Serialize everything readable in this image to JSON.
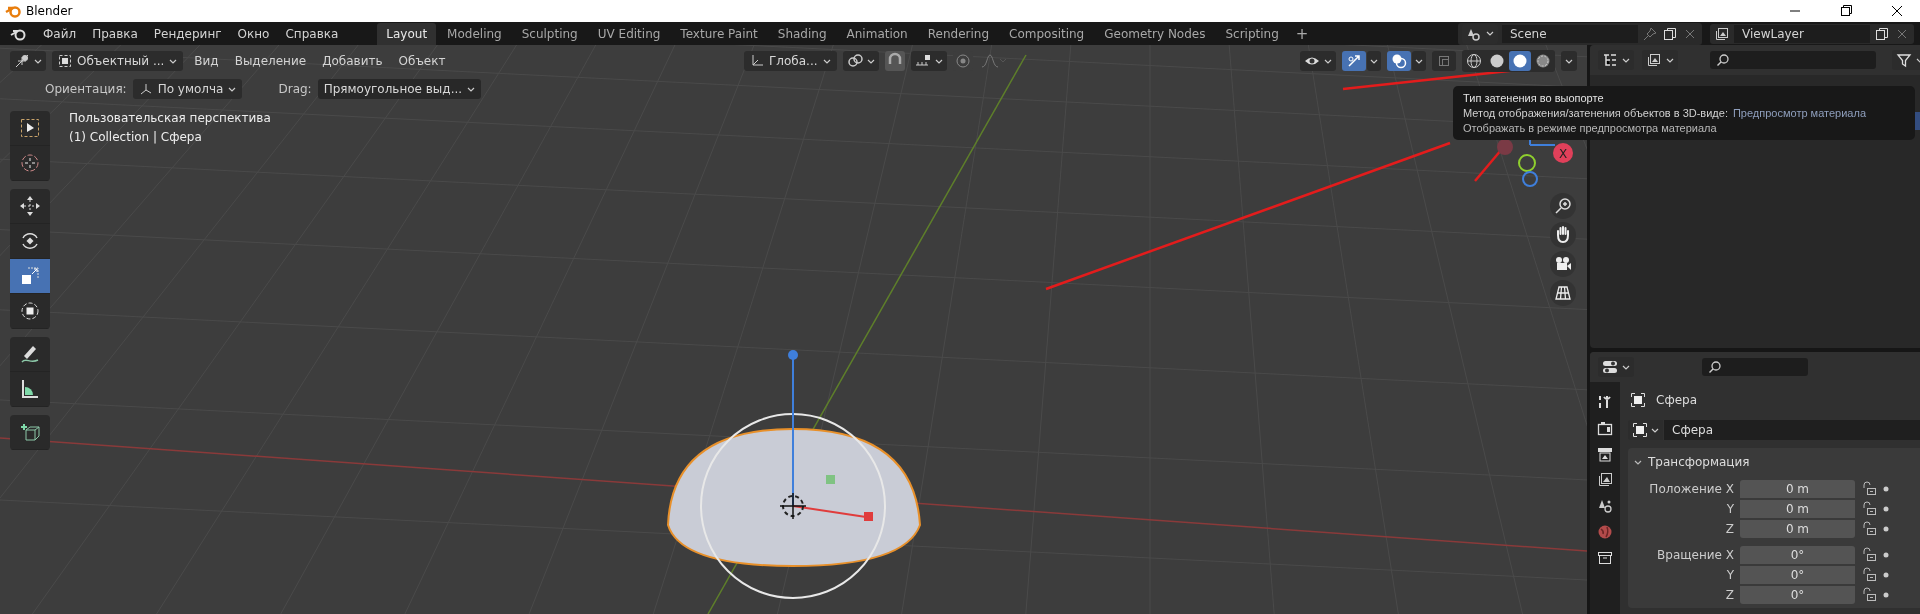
{
  "window": {
    "title": "Blender"
  },
  "menu": [
    "Файл",
    "Правка",
    "Рендеринг",
    "Окно",
    "Справка"
  ],
  "workspaces": [
    {
      "label": "Layout",
      "selected": true
    },
    {
      "label": "Modeling",
      "selected": false
    },
    {
      "label": "Sculpting",
      "selected": false
    },
    {
      "label": "UV Editing",
      "selected": false
    },
    {
      "label": "Texture Paint",
      "selected": false
    },
    {
      "label": "Shading",
      "selected": false
    },
    {
      "label": "Animation",
      "selected": false
    },
    {
      "label": "Rendering",
      "selected": false
    },
    {
      "label": "Compositing",
      "selected": false
    },
    {
      "label": "Geometry Nodes",
      "selected": false
    },
    {
      "label": "Scripting",
      "selected": false
    }
  ],
  "add_workspace": "+",
  "scene": {
    "name": "Scene"
  },
  "view_layer": {
    "name": "ViewLayer"
  },
  "viewport": {
    "mode": "Объектный ...",
    "menus": [
      "Вид",
      "Выделение",
      "Добавить",
      "Объект"
    ],
    "orientation": "Глоба...",
    "toggles": [
      {
        "kind": "gizmos",
        "on": true
      },
      {
        "kind": "overlays",
        "on": true
      },
      {
        "kind": "xray",
        "on": false
      }
    ],
    "shading": [
      {
        "kind": "wireframe",
        "selected": false
      },
      {
        "kind": "solid",
        "selected": false
      },
      {
        "kind": "material",
        "selected": true
      },
      {
        "kind": "rendered",
        "selected": false
      }
    ]
  },
  "tool_settings": {
    "orientation_label": "Ориентация:",
    "orientation": "По умолча",
    "drag_label": "Drag:",
    "drag": "Прямоугольное выд..."
  },
  "tool_groups": [
    {
      "tools": [
        {
          "kind": "select",
          "selected": false
        },
        {
          "kind": "cursor",
          "selected": false
        }
      ]
    },
    {
      "tools": [
        {
          "kind": "move",
          "selected": false
        },
        {
          "kind": "rotate",
          "selected": false
        },
        {
          "kind": "scale",
          "selected": true
        },
        {
          "kind": "transform",
          "selected": false
        }
      ]
    },
    {
      "tools": [
        {
          "kind": "annotate",
          "selected": false
        },
        {
          "kind": "measure",
          "selected": false
        }
      ]
    },
    {
      "tools": [
        {
          "kind": "add-cube",
          "selected": false
        }
      ]
    }
  ],
  "overlay_text": {
    "view": "Пользовательская перспектива",
    "collection": "(1) Collection | Сфера"
  },
  "gizmo": {
    "x_label": "X"
  },
  "tooltip": {
    "title": "Тип затенения во выопорте",
    "line": "Метод отображения/затенения объектов в 3D-виде:",
    "value": "Предпросмотр материала",
    "description": "Отображать в режиме предпросмотра материала"
  },
  "properties": {
    "object_name": "Сфера",
    "data_name": "Сфера",
    "panel": {
      "title": "Трансформация",
      "expanded": true,
      "rows": [
        {
          "label": "Положение X",
          "value": "0 m"
        },
        {
          "label": "Y",
          "value": "0 m"
        },
        {
          "label": "Z",
          "value": "0 m"
        },
        {
          "label": "Вращение X",
          "value": "0°"
        },
        {
          "label": "Y",
          "value": "0°"
        },
        {
          "label": "Z",
          "value": "0°"
        }
      ]
    }
  }
}
